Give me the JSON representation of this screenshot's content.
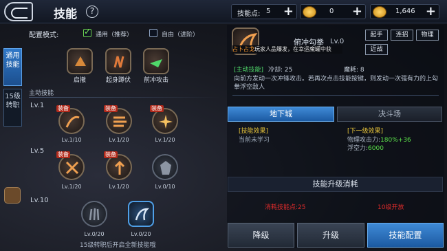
{
  "header": {
    "title": "技能",
    "help": "?",
    "skill_points_label": "技能点:",
    "skill_points": "5",
    "gold1": "0",
    "gold2": "1,646",
    "plus": "+"
  },
  "sidebar": {
    "tab1": "通用技能",
    "tab2": "15级转职"
  },
  "config": {
    "label": "配置模式:",
    "opt1": "通用（推荐）",
    "opt2": "自由（进阶）"
  },
  "common_skills": [
    "启撤",
    "起身蹲伏",
    "前冲攻击"
  ],
  "section_active": "主动技能",
  "levels": [
    "Lv.1",
    "Lv.5",
    "Lv.10"
  ],
  "equip_tag": "装备",
  "skills_row1": [
    "Lv.1/10",
    "Lv.1/20",
    "Lv.1/20"
  ],
  "skills_row2": [
    "Lv.1/20",
    "Lv.1/20",
    "Lv.0/10"
  ],
  "skills_row3": [
    "Lv.0/20",
    "Lv.0/20"
  ],
  "hint": "15级转职后开启全新技能哦",
  "detail": {
    "name": "俯冲勾拳",
    "level": "Lv.0",
    "tooltip_a": "占卜占戈",
    "tooltip_b": "玩家人品爆发，在幸运魔罐中获",
    "tags": [
      "起手",
      "连招",
      "物理",
      "近战"
    ],
    "type": "[主动技能]",
    "cd": "冷却: 25",
    "mp": "魔耗: 8",
    "desc": "向前方发动一次冲锋攻击。若再次点击技能按键，则发动一次强有力的上勾拳浮空敌人"
  },
  "modes": {
    "dungeon": "地下城",
    "arena": "决斗场"
  },
  "effect": {
    "title": "[技能效果]",
    "value": "当前未学习",
    "next_title": "[下一级效果]",
    "next1_label": "物理攻击力:",
    "next1_val": "180%+36",
    "next2_label": "浮空力:",
    "next2_val": "6000"
  },
  "cost": {
    "title": "技能升级消耗",
    "left": "消耗技能点:25",
    "right": "10级开放"
  },
  "buttons": {
    "down": "降级",
    "up": "升级",
    "config": "技能配置"
  }
}
